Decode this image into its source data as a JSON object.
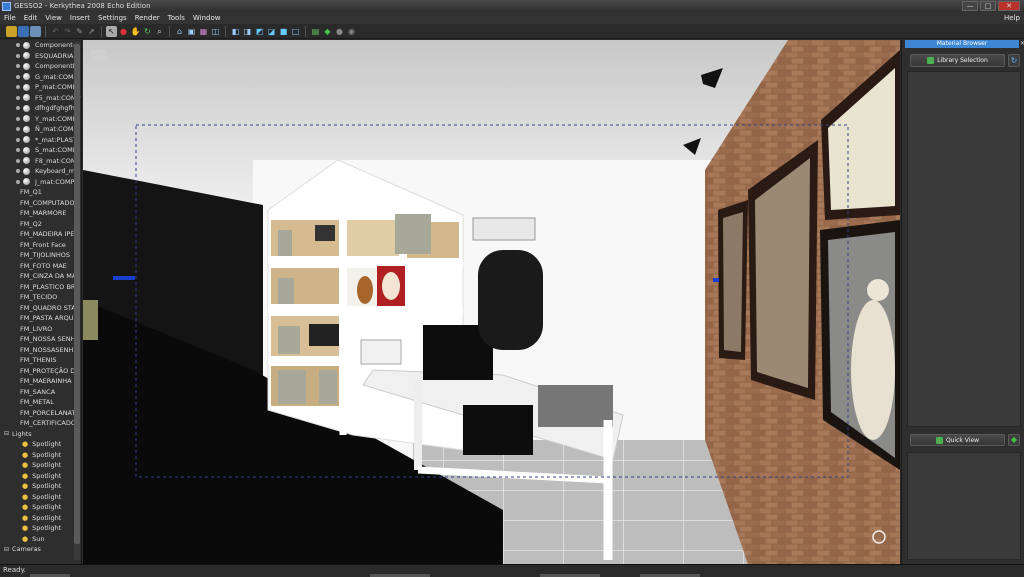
{
  "window": {
    "title": "GESSO2 - Kerkythea 2008 Echo Edition",
    "controls": [
      "—",
      "□",
      "✕"
    ]
  },
  "menu": [
    "File",
    "Edit",
    "View",
    "Insert",
    "Settings",
    "Render",
    "Tools",
    "Window"
  ],
  "help": "Help",
  "scene_tree": {
    "materials": [
      "Component#",
      "ESQUADRIA D",
      "ComponentR",
      "G_mat:COMP",
      "P_mat:COMP",
      "F5_mat:COMP",
      "dfhgdfghgfhf",
      "Y_mat:COMP",
      "Ñ_mat:COMP",
      "*_mat:PLASTI",
      "S_mat:COMPI",
      "F8_mat:COMI",
      "Keyboard_ma",
      "J_mat:COMPU"
    ],
    "models": [
      "FM_Q1",
      "FM_COMPUTADO",
      "FM_MARMORE",
      "FM_Q2",
      "FM_MADEIRA IPE",
      "FM_Front Face",
      "FM_TIJOLINHOS",
      "FM_FOTO MAE",
      "FM_CINZA DA MA",
      "FM_PLASTICO BR",
      "FM_TECIDO",
      "FM_QUADRO STA",
      "FM_PASTA ARQU",
      "FM_LIVRO",
      "FM_NOSSA SENH",
      "FM_NOSSASENHI",
      "FM_THENIS",
      "FM_PROTEÇÃO D",
      "FM_MAERAINHA",
      "FM_SANCA",
      "FM_METAL",
      "FM_PORCELANAT",
      "FM_CERTIFICADO"
    ],
    "lights_label": "Lights",
    "lights": [
      "Spotlight",
      "Spotlight",
      "Spotlight",
      "Spotlight",
      "Spotlight",
      "Spotlight",
      "Spotlight",
      "Spotlight",
      "Spotlight",
      "Sun"
    ],
    "cameras_label": "Cameras"
  },
  "material_browser": {
    "title": "Material Browser",
    "library_button": "Library Selection",
    "quick_view_button": "Quick View"
  },
  "status": "Ready.",
  "colors": {
    "accent": "#3c86d4",
    "panel": "#2e2e2e",
    "brick": "#9a6a4a"
  }
}
